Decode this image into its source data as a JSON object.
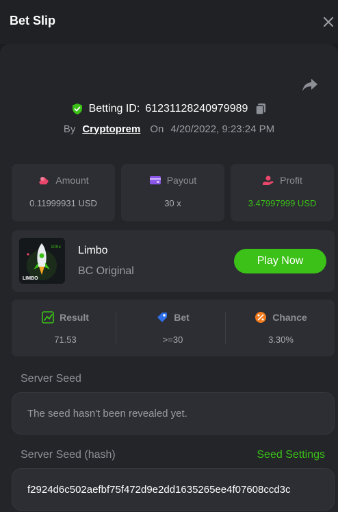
{
  "header": {
    "title": "Bet Slip"
  },
  "bet": {
    "id_label": "Betting ID:",
    "id": "61231128240979989",
    "by_label": "By",
    "user": "Cryptoprem",
    "on_label": "On",
    "datetime": "4/20/2022, 9:23:24 PM"
  },
  "stats": {
    "amount": {
      "label": "Amount",
      "value": "0.11999931 USD"
    },
    "payout": {
      "label": "Payout",
      "value": "30 x"
    },
    "profit": {
      "label": "Profit",
      "value": "3.47997999 USD"
    }
  },
  "game": {
    "name": "Limbo",
    "provider": "BC Original",
    "thumb_text": "LIMBO",
    "play_label": "Play Now"
  },
  "result": {
    "result": {
      "label": "Result",
      "value": "71.53"
    },
    "bet": {
      "label": "Bet",
      "value": ">=30"
    },
    "chance": {
      "label": "Chance",
      "value": "3.30%"
    }
  },
  "seeds": {
    "server_seed_label": "Server Seed",
    "server_seed_text": "The seed hasn't been revealed yet.",
    "server_seed_hash_label": "Server Seed (hash)",
    "seed_settings_label": "Seed Settings",
    "server_seed_hash": "f2924d6c502aefbf75f472d9e2dd1635265ee4f07608ccd3c"
  },
  "colors": {
    "accent_green": "#3bc117",
    "background": "#1a1c20",
    "panel": "#232529",
    "card": "#2c2e33"
  }
}
